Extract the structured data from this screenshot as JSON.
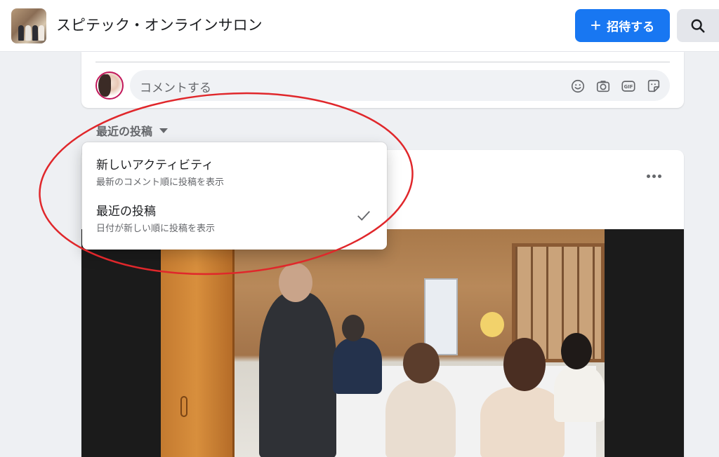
{
  "header": {
    "group_title": "スピテック・オンラインサロン",
    "invite_label": "招待する",
    "invite_icon": "plus-icon",
    "search_icon": "search-icon"
  },
  "composer": {
    "placeholder": "コメントする",
    "icons": [
      "emoji-icon",
      "camera-icon",
      "gif-icon",
      "sticker-icon"
    ]
  },
  "sort": {
    "current_label": "最近の投稿",
    "options": [
      {
        "title": "新しいアクティビティ",
        "description": "最新のコメント順に投稿を表示",
        "selected": false
      },
      {
        "title": "最近の投稿",
        "description": "日付が新しい順に投稿を表示",
        "selected": true
      }
    ]
  },
  "post": {
    "more_icon": "more-options-icon"
  },
  "colors": {
    "accent": "#1877f2",
    "annotation": "#e0272b",
    "background": "#eef0f3"
  }
}
